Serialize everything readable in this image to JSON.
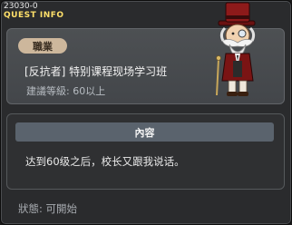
{
  "window": {
    "quest_id": "23030-0",
    "title": "QUEST INFO"
  },
  "info": {
    "job_badge": "職業",
    "quest_name": "[反抗者] 特别课程现场学习班",
    "recommended_level": "建議等級: 60以上",
    "npc_icon": "npc-top-hat-gentleman"
  },
  "content": {
    "header": "內容",
    "text": "达到60级之后，校长又跟我说话。"
  },
  "status": {
    "text": "狀態:  可開始"
  },
  "colors": {
    "title": "#ffe06a",
    "badge": "#cdb79c",
    "header": "#5a636d"
  }
}
